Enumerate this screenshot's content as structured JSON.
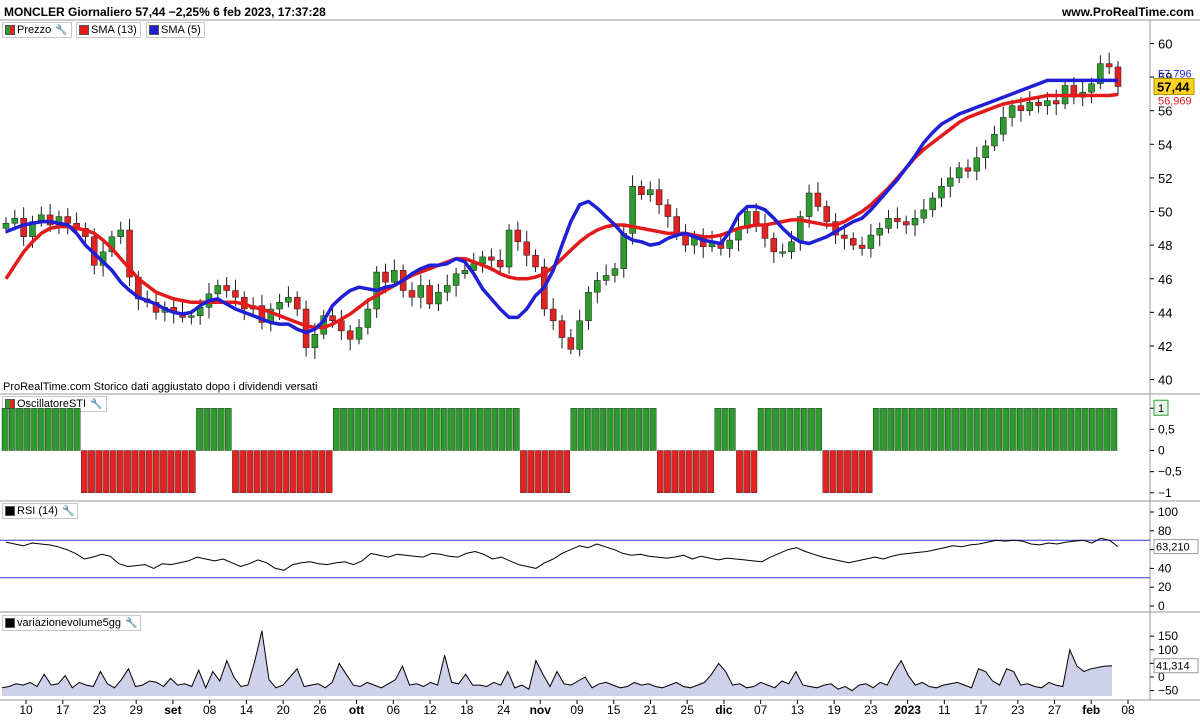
{
  "header": {
    "title": "MONCLER Giornaliero 57,44 −2,25% 6 feb 2023, 17:37:28",
    "website": "www.ProRealTime.com"
  },
  "watermark": "ProRealTime.com  Storico dati aggiustato dopo i dividendi versati",
  "legend": {
    "price": "Prezzo",
    "sma13": "SMA (13)",
    "sma5": "SMA (5)",
    "osc": "OscillatoreSTI",
    "rsi": "RSI (14)",
    "vol": "variazionevolume5gg"
  },
  "colors": {
    "up": "#2e9b2e",
    "down": "#e32222",
    "sma13": "#e31a1a",
    "sma5": "#1f1fd6",
    "rsi_line": "#000000",
    "rsi_levels": "#3333cc",
    "vol_fill": "#cfd0ea"
  },
  "chart_data": [
    {
      "type": "candlestick",
      "x": [
        "10",
        "17",
        "23",
        "29",
        "set",
        "08",
        "14",
        "20",
        "26",
        "ott",
        "06",
        "12",
        "18",
        "24",
        "nov",
        "09",
        "15",
        "21",
        "25",
        "dic",
        "07",
        "13",
        "19",
        "23",
        "2023",
        "11",
        "17",
        "23",
        "27",
        "feb",
        "08"
      ],
      "price_ylim": [
        39.5,
        60.8
      ],
      "y_ticks": [
        "60",
        "58",
        "56",
        "54",
        "52",
        "50",
        "48",
        "46",
        "44",
        "42",
        "40"
      ],
      "last_price": "57,44",
      "sma5_last": "57,796",
      "sma13_last": "56,969",
      "closes": [
        49.3,
        49.6,
        48.5,
        49.4,
        49.8,
        49.2,
        49.7,
        49.3,
        49.0,
        48.5,
        46.8,
        47.6,
        48.5,
        48.9,
        46.1,
        44.8,
        44.6,
        44.0,
        44.3,
        44.0,
        43.7,
        43.8,
        44.3,
        45.1,
        45.6,
        45.3,
        44.9,
        44.2,
        44.4,
        43.4,
        44.2,
        44.6,
        44.9,
        44.2,
        41.9,
        42.7,
        43.8,
        43.5,
        42.9,
        42.4,
        43.1,
        44.2,
        46.4,
        45.8,
        46.5,
        45.3,
        44.9,
        45.6,
        44.5,
        45.2,
        45.6,
        46.3,
        46.5,
        46.9,
        47.3,
        47.1,
        46.7,
        48.9,
        48.2,
        47.4,
        46.7,
        44.2,
        43.5,
        42.5,
        41.8,
        43.5,
        45.2,
        45.9,
        46.2,
        46.6,
        48.7,
        51.5,
        51.0,
        51.3,
        50.4,
        49.7,
        48.6,
        48.0,
        48.5,
        47.9,
        48.2,
        47.8,
        48.3,
        49.0,
        50.0,
        49.2,
        48.4,
        47.6,
        47.6,
        48.2,
        49.7,
        51.1,
        50.3,
        49.4,
        48.6,
        48.4,
        48.0,
        47.8,
        48.6,
        49.0,
        49.6,
        49.4,
        49.2,
        49.6,
        50.1,
        50.8,
        51.5,
        52.0,
        52.6,
        52.4,
        53.2,
        53.9,
        54.6,
        55.6,
        56.3,
        56.0,
        56.5,
        56.3,
        56.6,
        56.4,
        57.5,
        56.8,
        57.1,
        57.6,
        58.8,
        58.6,
        57.44
      ],
      "sma5": [
        48.8,
        49.0,
        49.2,
        49.3,
        49.4,
        49.4,
        49.3,
        49.2,
        48.7,
        48.0,
        47.5,
        47.0,
        46.5,
        45.8,
        45.3,
        44.9,
        44.7,
        44.5,
        44.2,
        44.0,
        43.9,
        44.0,
        44.4,
        44.7,
        44.8,
        44.5,
        44.2,
        44.0,
        43.8,
        43.6,
        43.4,
        43.3,
        43.3,
        43.0,
        42.8,
        43.0,
        43.5,
        44.4,
        44.9,
        45.3,
        45.5,
        45.4,
        45.3,
        45.5,
        45.6,
        45.9,
        46.3,
        46.6,
        46.8,
        46.8,
        46.9,
        47.2,
        47.0,
        46.3,
        45.4,
        44.8,
        44.2,
        43.7,
        43.7,
        44.2,
        45.0,
        45.5,
        46.5,
        48.0,
        49.4,
        50.4,
        50.6,
        50.2,
        49.7,
        49.2,
        48.6,
        48.3,
        48.2,
        48.0,
        48.1,
        48.4,
        48.6,
        48.7,
        48.5,
        48.3,
        48.2,
        48.1,
        48.8,
        49.8,
        50.3,
        50.3,
        50.1,
        49.6,
        49.0,
        48.5,
        48.2,
        48.1,
        48.3,
        48.5,
        48.8,
        49.1,
        49.4,
        49.6,
        50.1,
        50.7,
        51.3,
        51.9,
        52.6,
        53.3,
        54.1,
        54.7,
        55.2,
        55.5,
        55.8,
        56.0,
        56.2,
        56.4,
        56.6,
        56.8,
        57.0,
        57.2,
        57.4,
        57.6,
        57.8,
        57.8,
        57.8,
        57.8,
        57.8,
        57.8,
        57.8,
        57.8,
        57.8
      ],
      "sma13": [
        46.0,
        46.8,
        47.6,
        48.2,
        48.7,
        49.0,
        49.1,
        49.1,
        49.0,
        48.9,
        48.7,
        48.3,
        47.8,
        47.2,
        46.6,
        46.0,
        45.6,
        45.2,
        45.0,
        44.8,
        44.7,
        44.6,
        44.6,
        44.6,
        44.6,
        44.6,
        44.6,
        44.5,
        44.3,
        44.2,
        44.0,
        43.8,
        43.6,
        43.4,
        43.2,
        43.1,
        43.1,
        43.3,
        43.6,
        43.9,
        44.3,
        44.7,
        45.0,
        45.3,
        45.6,
        45.9,
        46.2,
        46.4,
        46.6,
        46.8,
        47.0,
        47.2,
        47.2,
        47.0,
        46.8,
        46.6,
        46.3,
        46.1,
        46.0,
        46.0,
        46.1,
        46.3,
        46.7,
        47.2,
        47.7,
        48.2,
        48.6,
        48.9,
        49.1,
        49.2,
        49.2,
        49.1,
        49.0,
        48.9,
        48.8,
        48.7,
        48.7,
        48.7,
        48.6,
        48.5,
        48.5,
        48.6,
        48.8,
        49.0,
        49.1,
        49.2,
        49.2,
        49.3,
        49.4,
        49.5,
        49.5,
        49.4,
        49.3,
        49.2,
        49.2,
        49.4,
        49.7,
        50.0,
        50.4,
        50.9,
        51.4,
        52.0,
        52.6,
        53.2,
        53.7,
        54.1,
        54.5,
        54.9,
        55.3,
        55.6,
        55.8,
        56.0,
        56.2,
        56.4,
        56.5,
        56.6,
        56.7,
        56.8,
        56.9,
        56.9,
        56.9,
        56.9,
        56.9,
        56.9,
        56.9,
        56.9,
        56.969
      ]
    },
    {
      "type": "bar",
      "name": "OscillatoreSTI",
      "ylim": [
        -1.1,
        1.1
      ],
      "y_ticks": [
        "1",
        "0,5",
        "0",
        "−0,5",
        "−1"
      ],
      "last_value": "1",
      "values": [
        1,
        1,
        1,
        1,
        1,
        1,
        1,
        1,
        1,
        1,
        1,
        -1,
        -1,
        -1,
        -1,
        -1,
        -1,
        -1,
        -1,
        -1,
        -1,
        -1,
        -1,
        -1,
        -1,
        -1,
        -1,
        1,
        1,
        1,
        1,
        1,
        -1,
        -1,
        -1,
        -1,
        -1,
        -1,
        -1,
        -1,
        -1,
        -1,
        -1,
        -1,
        -1,
        -1,
        1,
        1,
        1,
        1,
        1,
        1,
        1,
        1,
        1,
        1,
        1,
        1,
        1,
        1,
        1,
        1,
        1,
        1,
        1,
        1,
        1,
        1,
        1,
        1,
        1,
        1,
        -1,
        -1,
        -1,
        -1,
        -1,
        -1,
        -1,
        1,
        1,
        1,
        1,
        1,
        1,
        1,
        1,
        1,
        1,
        1,
        1,
        -1,
        -1,
        -1,
        -1,
        -1,
        -1,
        -1,
        -1,
        1,
        1,
        1,
        -1,
        -1,
        -1,
        1,
        1,
        1,
        1,
        1,
        1,
        1,
        1,
        1,
        -1,
        -1,
        -1,
        -1,
        -1,
        -1,
        -1,
        1,
        1,
        1,
        1,
        1,
        1,
        1,
        1,
        1,
        1,
        1,
        1,
        1,
        1,
        1,
        1,
        1,
        1,
        1,
        1,
        1,
        1,
        1,
        1,
        1,
        1,
        1,
        1,
        1,
        1,
        1,
        1,
        1,
        1
      ]
    },
    {
      "type": "line",
      "name": "RSI (14)",
      "ylim": [
        0,
        100
      ],
      "y_ticks": [
        "100",
        "80",
        "60",
        "40",
        "20",
        "0"
      ],
      "levels": [
        70,
        30
      ],
      "last_value": "63,210",
      "values": [
        68,
        66,
        64,
        67,
        66,
        65,
        63,
        60,
        56,
        50,
        52,
        55,
        53,
        45,
        42,
        43,
        44,
        40,
        45,
        44,
        46,
        48,
        52,
        50,
        48,
        50,
        46,
        42,
        45,
        49,
        46,
        40,
        38,
        44,
        46,
        47,
        45,
        44,
        46,
        47,
        44,
        48,
        56,
        54,
        52,
        55,
        54,
        53,
        52,
        56,
        55,
        53,
        52,
        56,
        58,
        55,
        50,
        52,
        48,
        44,
        42,
        40,
        46,
        50,
        56,
        60,
        64,
        62,
        66,
        63,
        60,
        56,
        54,
        55,
        53,
        52,
        51,
        52,
        54,
        50,
        53,
        51,
        49,
        51,
        50,
        49,
        48,
        47,
        52,
        56,
        60,
        62,
        58,
        55,
        52,
        50,
        48,
        46,
        48,
        50,
        52,
        50,
        53,
        55,
        56,
        57,
        58,
        60,
        62,
        64,
        63,
        65,
        66,
        68,
        70,
        69,
        70,
        69,
        66,
        65,
        67,
        66,
        68,
        69,
        70,
        67,
        72,
        70,
        63.2
      ]
    },
    {
      "type": "area",
      "name": "variazionevolume5gg",
      "ylim": [
        -70,
        180
      ],
      "y_ticks": [
        "150",
        "100",
        "50",
        "0",
        "−50"
      ],
      "last_value": "41,314",
      "values": [
        -40,
        -35,
        -25,
        -30,
        -20,
        -35,
        10,
        -30,
        -25,
        5,
        -40,
        -20,
        -30,
        -35,
        20,
        -25,
        -40,
        -10,
        30,
        -35,
        -30,
        -15,
        -20,
        -35,
        -5,
        -30,
        -25,
        -35,
        25,
        -40,
        20,
        -15,
        60,
        0,
        -35,
        -30,
        60,
        170,
        -10,
        -40,
        -30,
        0,
        30,
        -35,
        -30,
        -25,
        -40,
        -20,
        50,
        10,
        -30,
        -35,
        -20,
        -30,
        -40,
        -25,
        -10,
        40,
        -30,
        -25,
        -35,
        -20,
        -30,
        80,
        -20,
        -25,
        10,
        -30,
        -30,
        -35,
        -20,
        -30,
        20,
        -40,
        -30,
        -45,
        60,
        10,
        -35,
        20,
        -25,
        -30,
        -15,
        0,
        -40,
        -25,
        -20,
        -30,
        -40,
        -35,
        -20,
        -30,
        -25,
        -35,
        -40,
        -30,
        -20,
        -35,
        -40,
        -30,
        -20,
        10,
        50,
        20,
        -30,
        -25,
        -40,
        -35,
        -20,
        -30,
        -40,
        -15,
        -25,
        20,
        -30,
        -35,
        -40,
        -30,
        -25,
        -45,
        -35,
        -50,
        -30,
        -25,
        -40,
        -20,
        -30,
        20,
        60,
        5,
        -30,
        -20,
        -35,
        -40,
        -30,
        -25,
        -20,
        -30,
        -40,
        30,
        20,
        -15,
        -30,
        30,
        20,
        -30,
        -25,
        -35,
        -40,
        -20,
        -30,
        -35,
        100,
        40,
        20,
        30,
        35,
        40,
        41.3
      ]
    }
  ]
}
